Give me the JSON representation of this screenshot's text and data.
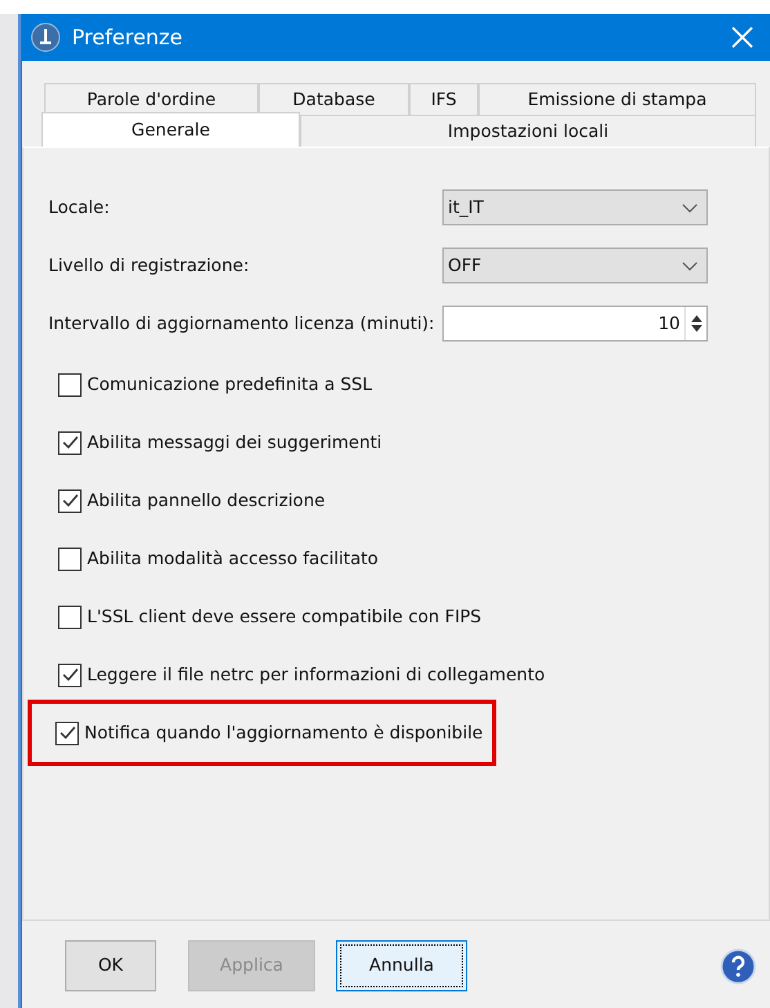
{
  "window": {
    "title": "Preferenze"
  },
  "tab_rows": [
    [
      {
        "label": "Parole d'ordine",
        "selected": false
      },
      {
        "label": "Database",
        "selected": false
      },
      {
        "label": "IFS",
        "selected": false
      },
      {
        "label": "Emissione di stampa",
        "selected": false
      }
    ],
    [
      {
        "label": "Generale",
        "selected": true
      },
      {
        "label": "Impostazioni locali",
        "selected": false
      }
    ]
  ],
  "fields": [
    {
      "kind": "select",
      "label": "Locale:",
      "value": "it_IT"
    },
    {
      "kind": "select",
      "label": "Livello di registrazione:",
      "value": "OFF"
    },
    {
      "kind": "spinner",
      "label": "Intervallo di aggiornamento licenza (minuti):",
      "value": "10"
    }
  ],
  "checkboxes": [
    {
      "label": "Comunicazione predefinita a SSL",
      "checked": false,
      "highlighted": false
    },
    {
      "label": "Abilita messaggi dei suggerimenti",
      "checked": true,
      "highlighted": false
    },
    {
      "label": "Abilita pannello descrizione",
      "checked": true,
      "highlighted": false
    },
    {
      "label": "Abilita modalità accesso facilitato",
      "checked": false,
      "highlighted": false
    },
    {
      "label": "L'SSL client deve essere compatibile con FIPS",
      "checked": false,
      "highlighted": false
    },
    {
      "label": "Leggere il file netrc per informazioni di collegamento",
      "checked": true,
      "highlighted": false
    },
    {
      "label": "Notifica quando l'aggiornamento è disponibile",
      "checked": true,
      "highlighted": true
    }
  ],
  "buttons": [
    {
      "label": "OK",
      "disabled": false,
      "focused": false
    },
    {
      "label": "Applica",
      "disabled": true,
      "focused": false
    },
    {
      "label": "Annulla",
      "disabled": false,
      "focused": true
    }
  ]
}
